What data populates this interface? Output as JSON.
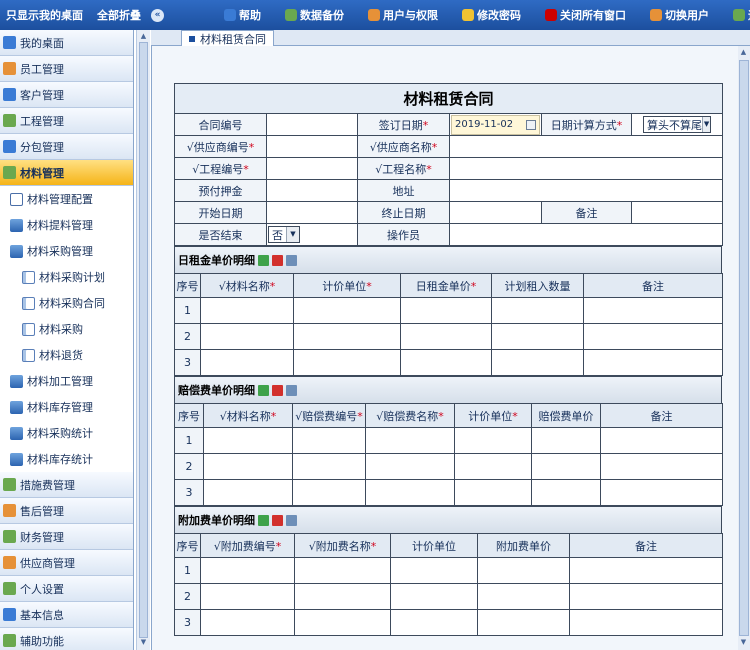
{
  "topbar": {
    "show_desktop": "只显示我的桌面",
    "collapse_all": "全部折叠",
    "nav": [
      {
        "label": "帮助",
        "icon": "help-icon",
        "color": "#3a7bd5"
      },
      {
        "label": "数据备份",
        "icon": "backup-icon",
        "color": "#6aa84f"
      },
      {
        "label": "用户与权限",
        "icon": "users-icon",
        "color": "#e69138"
      },
      {
        "label": "修改密码",
        "icon": "password-icon",
        "color": "#f1c232"
      },
      {
        "label": "关闭所有窗口",
        "icon": "close-all-icon",
        "color": "#cc0000"
      },
      {
        "label": "切换用户",
        "icon": "switch-user-icon",
        "color": "#e69138"
      },
      {
        "label": "退出",
        "icon": "exit-icon",
        "color": "#6aa84f"
      }
    ]
  },
  "sidebar": {
    "items": [
      {
        "label": "我的桌面",
        "type": "top",
        "icon": "desktop-icon"
      },
      {
        "label": "员工管理",
        "type": "top",
        "icon": "employee-icon"
      },
      {
        "label": "客户管理",
        "type": "top",
        "icon": "customer-icon"
      },
      {
        "label": "工程管理",
        "type": "top",
        "icon": "project-icon"
      },
      {
        "label": "分包管理",
        "type": "top",
        "icon": "subcontract-icon"
      },
      {
        "label": "材料管理",
        "type": "top",
        "icon": "material-icon",
        "active": true
      },
      {
        "label": "材料管理配置",
        "type": "sub",
        "icon": "document-icon"
      },
      {
        "label": "材料提料管理",
        "type": "sub",
        "icon": "folder-icon"
      },
      {
        "label": "材料采购管理",
        "type": "sub",
        "icon": "folder-icon"
      },
      {
        "label": "材料采购计划",
        "type": "sub2",
        "icon": "page-icon"
      },
      {
        "label": "材料采购合同",
        "type": "sub2",
        "icon": "page-icon"
      },
      {
        "label": "材料采购",
        "type": "sub2",
        "icon": "page-icon"
      },
      {
        "label": "材料退货",
        "type": "sub2",
        "icon": "page-icon"
      },
      {
        "label": "材料加工管理",
        "type": "sub",
        "icon": "folder-icon"
      },
      {
        "label": "材料库存管理",
        "type": "sub",
        "icon": "folder-icon"
      },
      {
        "label": "材料采购统计",
        "type": "sub",
        "icon": "folder-icon"
      },
      {
        "label": "材料库存统计",
        "type": "sub",
        "icon": "folder-icon"
      },
      {
        "label": "措施费管理",
        "type": "top",
        "icon": "measure-icon"
      },
      {
        "label": "售后管理",
        "type": "top",
        "icon": "aftersale-icon"
      },
      {
        "label": "财务管理",
        "type": "top",
        "icon": "finance-icon"
      },
      {
        "label": "供应商管理",
        "type": "top",
        "icon": "supplier-icon"
      },
      {
        "label": "个人设置",
        "type": "top",
        "icon": "personal-icon"
      },
      {
        "label": "基本信息",
        "type": "top",
        "icon": "info-icon"
      },
      {
        "label": "辅助功能",
        "type": "top",
        "icon": "assist-icon"
      }
    ]
  },
  "tab": {
    "label": "材料租赁合同"
  },
  "form": {
    "title": "材料租赁合同",
    "contract_no": "合同编号",
    "sign_date": "签订日期",
    "sign_date_value": "2019-11-02",
    "date_calc": "日期计算方式",
    "date_calc_value": "算头不算尾",
    "supplier_no": "√供应商编号",
    "supplier_name": "√供应商名称",
    "project_no": "√工程编号",
    "project_name": "√工程名称",
    "deposit": "预付押金",
    "address": "地址",
    "start_date": "开始日期",
    "end_date": "终止日期",
    "remark": "备注",
    "finished": "是否结束",
    "finished_value": "否",
    "operator": "操作员",
    "star": "*"
  },
  "sections": {
    "daily": {
      "title": "日租金单价明细",
      "headers": [
        "序号",
        "√材料名称",
        "计价单位",
        "日租金单价",
        "计划租入数量",
        "备注"
      ],
      "required": [
        false,
        true,
        true,
        true,
        false,
        false
      ],
      "rows": [
        "1",
        "2",
        "3"
      ]
    },
    "comp": {
      "title": "赔偿费单价明细",
      "headers": [
        "序号",
        "√材料名称",
        "√赔偿费编号",
        "√赔偿费名称",
        "计价单位",
        "赔偿费单价",
        "备注"
      ],
      "required": [
        false,
        true,
        true,
        true,
        true,
        false,
        false
      ],
      "rows": [
        "1",
        "2",
        "3"
      ]
    },
    "extra": {
      "title": "附加费单价明细",
      "headers": [
        "序号",
        "√附加费编号",
        "√附加费名称",
        "计价单位",
        "附加费单价",
        "备注"
      ],
      "required": [
        false,
        true,
        true,
        false,
        false,
        false
      ],
      "rows": [
        "1",
        "2",
        "3"
      ]
    }
  }
}
